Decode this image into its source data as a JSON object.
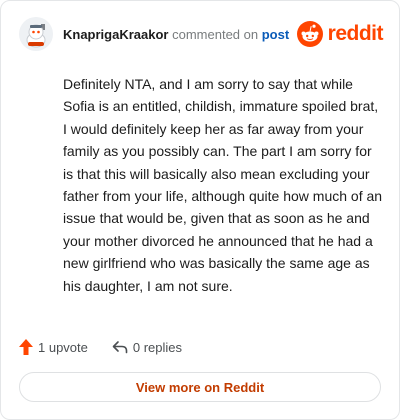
{
  "comment": {
    "author": "KnaprigaKraakor",
    "action_text": "commented on",
    "post_link": "post",
    "body": "Definitely NTA, and I am sorry to say that while Sofia is an entitled, childish, immature spoiled brat, I would definitely keep her as far away from your family as you possibly can. The part I am sorry for is that this will basically also mean excluding your father from your life, although quite how much of an issue that would be, given that as soon as he and your mother divorced he announced that he had a new girlfriend who was basically the same age as his daughter, I am not sure."
  },
  "brand": {
    "wordmark": "reddit",
    "icon": "reddit-logo-icon",
    "color": "#ff4500"
  },
  "actions": {
    "upvotes": "1 upvote",
    "replies": "0 replies",
    "upvote_icon": "upvote-arrow-icon",
    "reply_icon": "reply-icon",
    "upvote_color": "#ff4500"
  },
  "cta": {
    "label": "View more on Reddit",
    "color": "#c23c00"
  },
  "colors": {
    "link": "#0a5bb8",
    "text": "#1c1c1c",
    "muted": "#787c7e",
    "border": "#e4e6e8"
  }
}
